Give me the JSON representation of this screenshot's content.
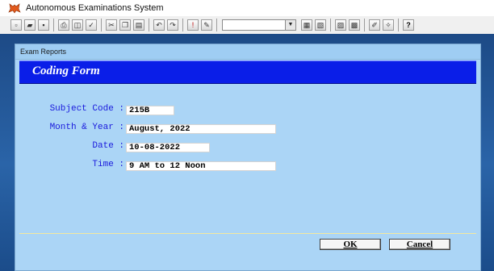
{
  "app": {
    "title": "Autonomous Examinations System"
  },
  "toolbar": {
    "buttons": [
      "new-icon",
      "open-icon",
      "save-icon",
      "print-icon",
      "print-preview-icon",
      "spell-check-icon",
      "cut-icon",
      "copy-icon",
      "paste-icon",
      "undo-icon",
      "redo-icon",
      "run-icon",
      "modify-icon",
      "view-icon",
      "form-icon",
      "report-icon",
      "table-icon",
      "edit-icon",
      "help-icon"
    ],
    "combo_value": ""
  },
  "window": {
    "title": "Exam Reports"
  },
  "form": {
    "heading": "Coding Form",
    "fields": [
      {
        "label": "Subject Code :",
        "value": "215B"
      },
      {
        "label": "Month & Year :",
        "value": "August, 2022"
      },
      {
        "label": "Date :",
        "value": "10-08-2022"
      },
      {
        "label": "Time :",
        "value": "9 AM to 12 Noon"
      }
    ],
    "ok_label": "OK",
    "cancel_label": "Cancel"
  },
  "colors": {
    "banner": "#0a1ee8",
    "form_background": "#abd5f6",
    "label_text": "#1a1adc"
  }
}
